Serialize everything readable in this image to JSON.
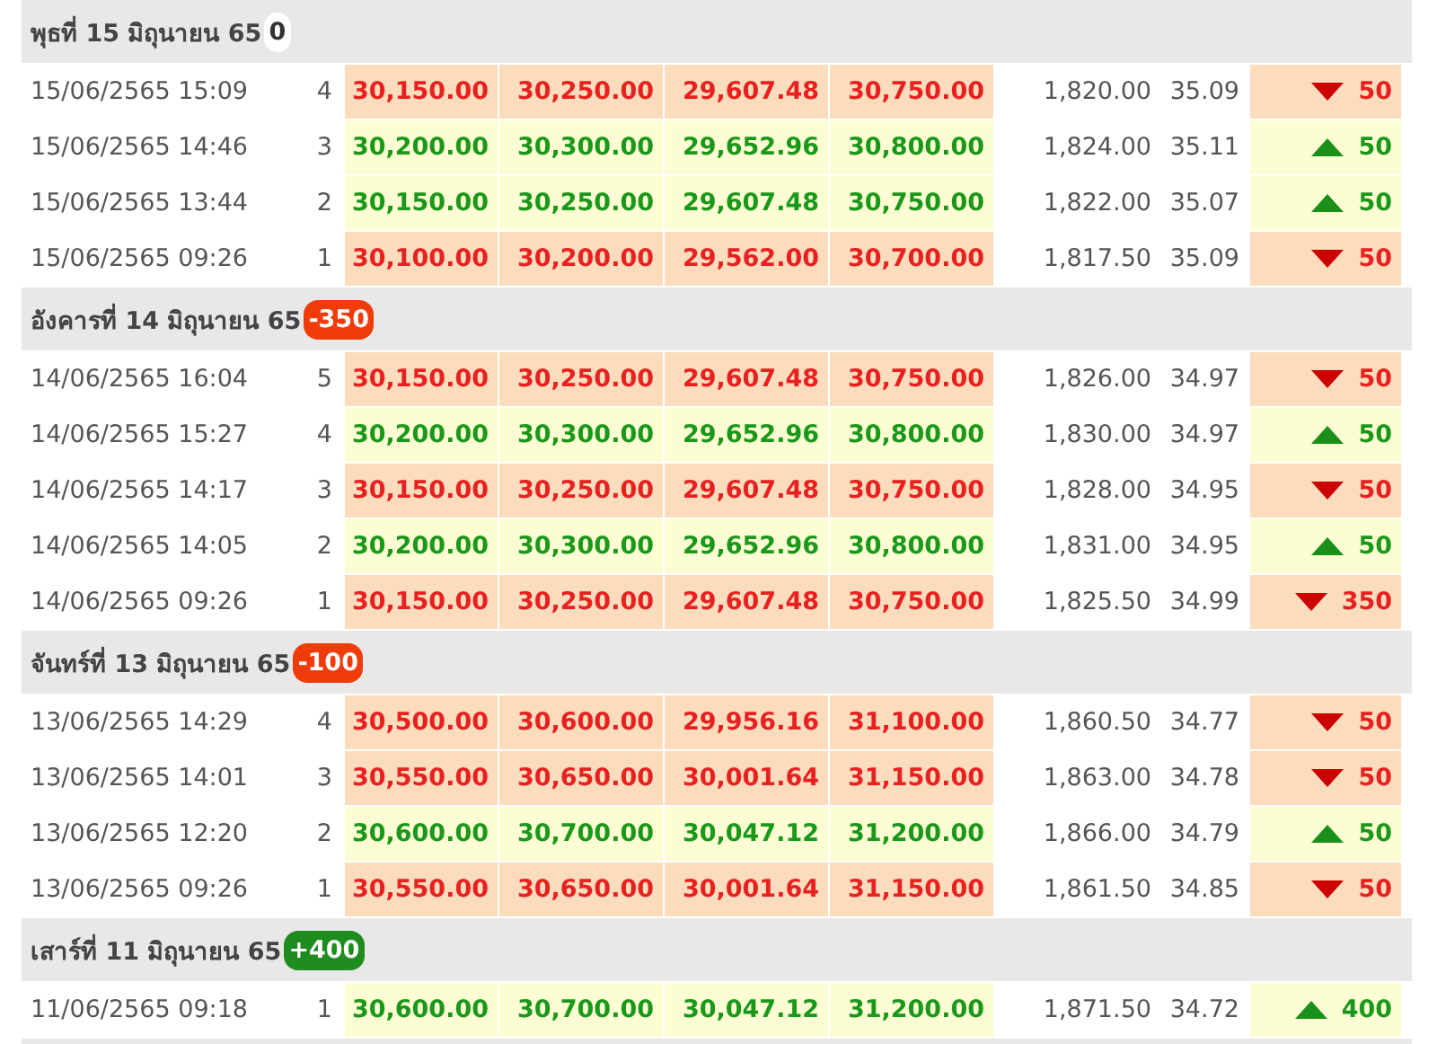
{
  "days": [
    {
      "title": "พุธที่ 15 มิถุนายน 65",
      "change": "0",
      "color": "#ffffff",
      "rows": [
        {
          "time": "15/06/2565 15:09",
          "seq": "4",
          "prices": [
            "30,150.00",
            "30,250.00",
            "29,607.48",
            "30,750.00"
          ],
          "value_1": "1,820.00",
          "value_2": "35.09",
          "rising": false,
          "change": "50"
        },
        {
          "time": "15/06/2565 14:46",
          "seq": "3",
          "prices": [
            "30,200.00",
            "30,300.00",
            "29,652.96",
            "30,800.00"
          ],
          "value_1": "1,824.00",
          "value_2": "35.11",
          "rising": true,
          "change": "50"
        },
        {
          "time": "15/06/2565 13:44",
          "seq": "2",
          "prices": [
            "30,150.00",
            "30,250.00",
            "29,607.48",
            "30,750.00"
          ],
          "value_1": "1,822.00",
          "value_2": "35.07",
          "rising": true,
          "change": "50"
        },
        {
          "time": "15/06/2565 09:26",
          "seq": "1",
          "prices": [
            "30,100.00",
            "30,200.00",
            "29,562.00",
            "30,700.00"
          ],
          "value_1": "1,817.50",
          "value_2": "35.09",
          "rising": false,
          "change": "50"
        }
      ]
    },
    {
      "title": "อังคารที่ 14 มิถุนายน 65",
      "change": "-350",
      "color": "#f03c0a",
      "rows": [
        {
          "time": "14/06/2565 16:04",
          "seq": "5",
          "prices": [
            "30,150.00",
            "30,250.00",
            "29,607.48",
            "30,750.00"
          ],
          "value_1": "1,826.00",
          "value_2": "34.97",
          "rising": false,
          "change": "50"
        },
        {
          "time": "14/06/2565 15:27",
          "seq": "4",
          "prices": [
            "30,200.00",
            "30,300.00",
            "29,652.96",
            "30,800.00"
          ],
          "value_1": "1,830.00",
          "value_2": "34.97",
          "rising": true,
          "change": "50"
        },
        {
          "time": "14/06/2565 14:17",
          "seq": "3",
          "prices": [
            "30,150.00",
            "30,250.00",
            "29,607.48",
            "30,750.00"
          ],
          "value_1": "1,828.00",
          "value_2": "34.95",
          "rising": false,
          "change": "50"
        },
        {
          "time": "14/06/2565 14:05",
          "seq": "2",
          "prices": [
            "30,200.00",
            "30,300.00",
            "29,652.96",
            "30,800.00"
          ],
          "value_1": "1,831.00",
          "value_2": "34.95",
          "rising": true,
          "change": "50"
        },
        {
          "time": "14/06/2565 09:26",
          "seq": "1",
          "prices": [
            "30,150.00",
            "30,250.00",
            "29,607.48",
            "30,750.00"
          ],
          "value_1": "1,825.50",
          "value_2": "34.99",
          "rising": false,
          "change": "350"
        }
      ]
    },
    {
      "title": "จันทร์ที่ 13 มิถุนายน 65",
      "change": "-100",
      "color": "#f03c0a",
      "rows": [
        {
          "time": "13/06/2565 14:29",
          "seq": "4",
          "prices": [
            "30,500.00",
            "30,600.00",
            "29,956.16",
            "31,100.00"
          ],
          "value_1": "1,860.50",
          "value_2": "34.77",
          "rising": false,
          "change": "50"
        },
        {
          "time": "13/06/2565 14:01",
          "seq": "3",
          "prices": [
            "30,550.00",
            "30,650.00",
            "30,001.64",
            "31,150.00"
          ],
          "value_1": "1,863.00",
          "value_2": "34.78",
          "rising": false,
          "change": "50"
        },
        {
          "time": "13/06/2565 12:20",
          "seq": "2",
          "prices": [
            "30,600.00",
            "30,700.00",
            "30,047.12",
            "31,200.00"
          ],
          "value_1": "1,866.00",
          "value_2": "34.79",
          "rising": true,
          "change": "50"
        },
        {
          "time": "13/06/2565 09:26",
          "seq": "1",
          "prices": [
            "30,550.00",
            "30,650.00",
            "30,001.64",
            "31,150.00"
          ],
          "value_1": "1,861.50",
          "value_2": "34.85",
          "rising": false,
          "change": "50"
        }
      ]
    },
    {
      "title": "เสาร์ที่ 11 มิถุนายน 65",
      "change": "+400",
      "color": "#1e8c1e",
      "rows": [
        {
          "time": "11/06/2565 09:18",
          "seq": "1",
          "prices": [
            "30,600.00",
            "30,700.00",
            "30,047.12",
            "31,200.00"
          ],
          "value_1": "1,871.50",
          "value_2": "34.72",
          "rising": true,
          "change": "400"
        }
      ]
    }
  ]
}
